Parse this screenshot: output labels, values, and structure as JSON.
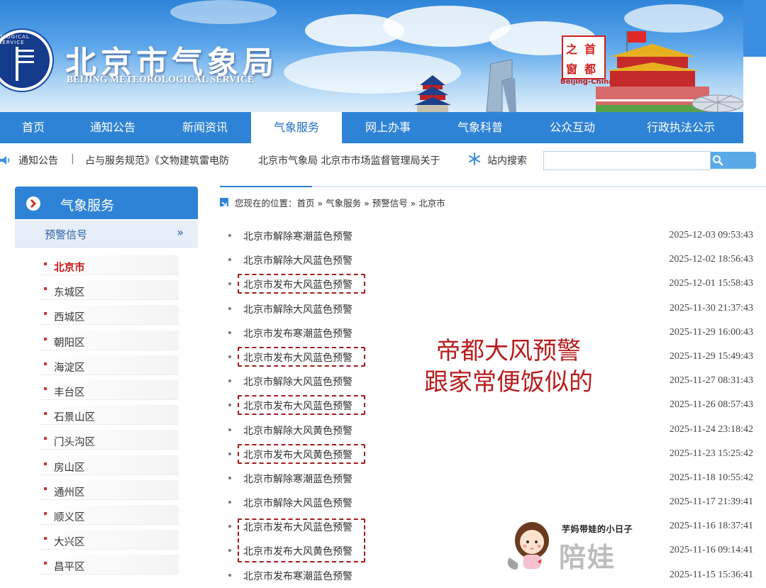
{
  "banner": {
    "title": "北京市气象局",
    "subtitle": "BEIJING METEOROLOGICAL SERVICE",
    "badge_chars": [
      "首",
      "都",
      "之",
      "窗"
    ],
    "badge_caption": "Beijing-China",
    "logo_ring_text": "OLOGICAL SERVICE"
  },
  "nav": {
    "items": [
      {
        "label": "首页",
        "active": false
      },
      {
        "label": "通知公告",
        "active": false
      },
      {
        "label": "新闻资讯",
        "active": false
      },
      {
        "label": "气象服务",
        "active": true
      },
      {
        "label": "网上办事",
        "active": false
      },
      {
        "label": "气象科普",
        "active": false
      },
      {
        "label": "公众互动",
        "active": false
      },
      {
        "label": "行政执法公示",
        "active": false
      }
    ]
  },
  "ticker": {
    "label": "通知公告",
    "separator": "|",
    "text": "占与服务规范》《文物建筑雷电防",
    "text2": "北京市气象局 北京市市场监督管理局关于"
  },
  "site_search": {
    "label": "站内搜索",
    "placeholder": "",
    "button_icon": "search-icon"
  },
  "sidebar": {
    "title": "气象服务",
    "sub_label": "预警信号",
    "sub_arrow": "»",
    "districts": [
      {
        "label": "北京市",
        "active": true
      },
      {
        "label": "东城区",
        "active": false
      },
      {
        "label": "西城区",
        "active": false
      },
      {
        "label": "朝阳区",
        "active": false
      },
      {
        "label": "海淀区",
        "active": false
      },
      {
        "label": "丰台区",
        "active": false
      },
      {
        "label": "石景山区",
        "active": false
      },
      {
        "label": "门头沟区",
        "active": false
      },
      {
        "label": "房山区",
        "active": false
      },
      {
        "label": "通州区",
        "active": false
      },
      {
        "label": "顺义区",
        "active": false
      },
      {
        "label": "大兴区",
        "active": false
      },
      {
        "label": "昌平区",
        "active": false
      }
    ]
  },
  "breadcrumb": {
    "text": "您现在的位置：首页 » 气象服务 » 预警信号 » 北京市"
  },
  "warnings": [
    {
      "title": "北京市解除寒潮蓝色预警",
      "date": "2025-12-03 09:53:43",
      "boxed": false
    },
    {
      "title": "北京市解除大风蓝色预警",
      "date": "2025-12-02 18:56:43",
      "boxed": false
    },
    {
      "title": "北京市发布大风蓝色预警",
      "date": "2025-12-01 15:58:43",
      "boxed": true
    },
    {
      "title": "北京市解除大风蓝色预警",
      "date": "2025-11-30 21:37:43",
      "boxed": false
    },
    {
      "title": "北京市发布寒潮蓝色预警",
      "date": "2025-11-29 16:00:43",
      "boxed": false
    },
    {
      "title": "北京市发布大风蓝色预警",
      "date": "2025-11-29 15:49:43",
      "boxed": true
    },
    {
      "title": "北京市解除大风蓝色预警",
      "date": "2025-11-27 08:31:43",
      "boxed": false
    },
    {
      "title": "北京市发布大风蓝色预警",
      "date": "2025-11-26 08:57:43",
      "boxed": true
    },
    {
      "title": "北京市解除大风黄色预警",
      "date": "2025-11-24 23:18:42",
      "boxed": false
    },
    {
      "title": "北京市发布大风黄色预警",
      "date": "2025-11-23 15:25:42",
      "boxed": true
    },
    {
      "title": "北京市解除寒潮蓝色预警",
      "date": "2025-11-18 10:55:42",
      "boxed": false
    },
    {
      "title": "北京市解除大风蓝色预警",
      "date": "2025-11-17 21:39:41",
      "boxed": false
    },
    {
      "title": "北京市发布大风蓝色预警",
      "date": "2025-11-16 18:37:41",
      "boxed": false
    },
    {
      "title": "北京市发布大风黄色预警",
      "date": "2025-11-16 09:14:41",
      "boxed": false
    },
    {
      "title": "北京市发布寒潮蓝色预警",
      "date": "2025-11-15 15:36:41",
      "boxed": false
    }
  ],
  "annotation": {
    "line1": "帝都大风预警",
    "line2": "跟家常便饭似的"
  },
  "watermark": {
    "caption": "芋妈带娃的小日子",
    "brand": "陪娃"
  },
  "colors": {
    "nav_blue": "#2f83d6",
    "annotation_red": "#b81d1d",
    "active_district": "#c81818"
  }
}
